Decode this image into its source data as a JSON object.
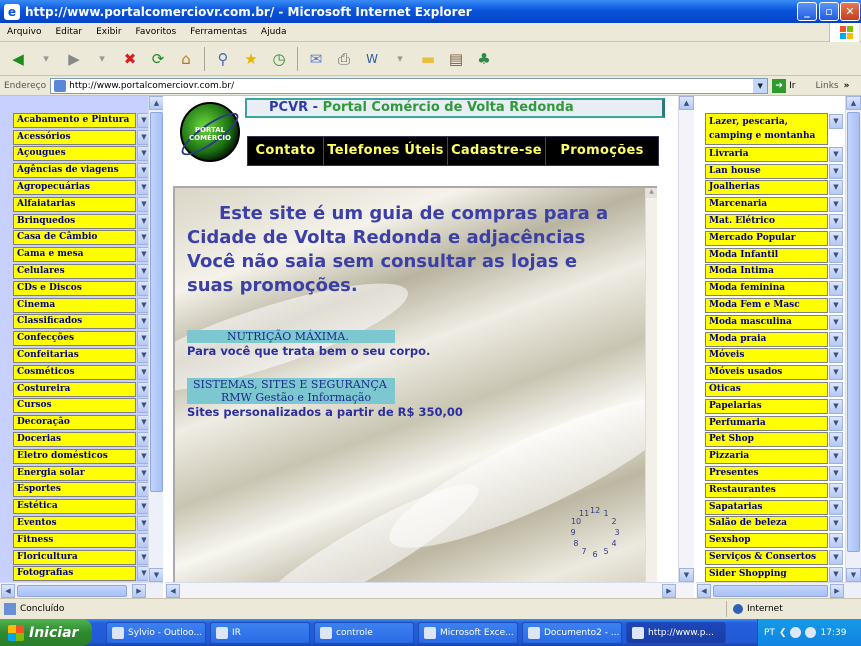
{
  "window": {
    "title": "http://www.portalcomerciovr.com.br/ - Microsoft Internet Explorer",
    "minimize_glyph": "_",
    "maximize_glyph": "▫",
    "close_glyph": "✕"
  },
  "menubar": {
    "items": [
      "Arquivo",
      "Editar",
      "Exibir",
      "Favoritos",
      "Ferramentas",
      "Ajuda"
    ]
  },
  "toolbar": {
    "icons": [
      "back-icon",
      "forward-icon",
      "stop-icon",
      "refresh-icon",
      "home-icon",
      "search-icon",
      "favorites-icon",
      "history-icon",
      "mail-icon",
      "print-icon",
      "edit-icon",
      "folder-icon",
      "research-icon",
      "messenger-icon"
    ]
  },
  "addressbar": {
    "label": "Endereço",
    "url": "http://www.portalcomerciovr.com.br/",
    "go_label": "Ir",
    "links_label": "Links"
  },
  "site": {
    "logo_text": "PORTAL COMÉRCIO",
    "title_part1": "PCVR - ",
    "title_part2": "Portal Comércio de Volta Redonda",
    "topnav": [
      "Contato",
      "Telefones Úteis",
      "Cadastre-se",
      "Promoções"
    ],
    "lead": "Este site é um guia de compras para a Cidade de Volta Redonda e adjacências Você não saia sem consultar as lojas e suas promoções.",
    "promos": [
      {
        "boxes": [
          "NUTRIÇÃO MÁXIMA."
        ],
        "desc": "Para você que trata bem o seu corpo."
      },
      {
        "boxes": [
          "SISTEMAS, SITES E SEGURANÇA",
          "RMW Gestão e Informação"
        ],
        "desc": "Sites personalizados a partir de R$ 350,00"
      }
    ],
    "clock_numbers": [
      "12",
      "1",
      "2",
      "3",
      "4",
      "5",
      "6",
      "7",
      "8",
      "9",
      "10",
      "11"
    ]
  },
  "left_nav": [
    "Acabamento e Pintura",
    "Acessórios",
    "Açougues",
    "Agências de viagens",
    "Agropecuárias",
    "Alfaiatarias",
    "Brinquedos",
    "Casa de Câmbio",
    "Cama e mesa",
    "Celulares",
    "CDs e Discos",
    "Cinema",
    "Classificados",
    "Confecções",
    "Confeitarias",
    "Cosméticos",
    "Costureira",
    "Cursos",
    "Decoração",
    "Docerias",
    "Eletro domésticos",
    "Energia solar",
    "Esportes",
    "Estética",
    "Eventos",
    "Fitness",
    "Floricultura",
    "Fotografias"
  ],
  "right_nav": [
    "Lazer, pescaria, camping e montanha",
    "Livraria",
    "Lan house",
    "Joalherias",
    "Marcenaria",
    "Mat. Elétrico",
    "Mercado Popular",
    "Moda Infantil",
    "Moda Intima",
    "Moda feminina",
    "Moda Fem e Masc",
    "Moda masculina",
    "Moda praia",
    "Móveis",
    "Móveis usados",
    "Óticas",
    "Papelarias",
    "Perfumaria",
    "Pet Shop",
    "Pizzaria",
    "Presentes",
    "Restaurantes",
    "Sapatarias",
    "Salão de beleza",
    "Sexshop",
    "Serviços & Consertos",
    "Sider Shopping"
  ],
  "statusbar": {
    "text": "Concluído",
    "zone": "Internet"
  },
  "taskbar": {
    "start": "Iniciar",
    "tasks": [
      "Sylvio - Outloo...",
      "IR",
      "controle",
      "Microsoft Exce...",
      "Documento2 - ...",
      "http://www.p..."
    ],
    "lang": "PT",
    "time": "17:39"
  }
}
